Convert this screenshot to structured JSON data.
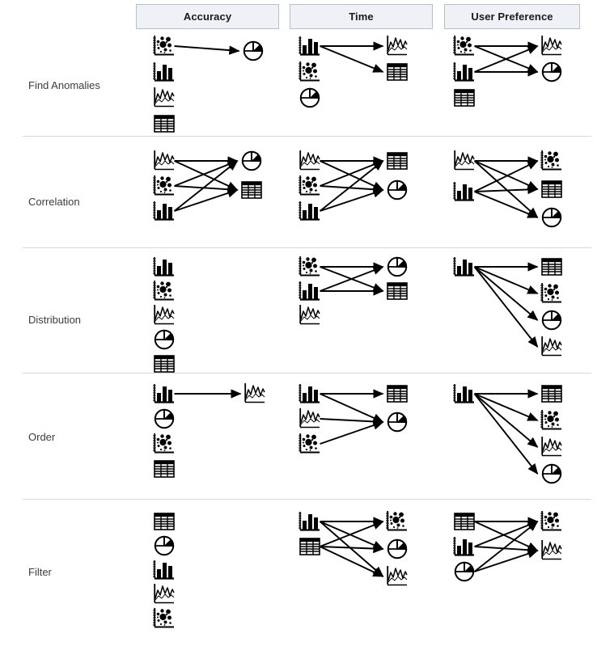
{
  "figure": {
    "type": "matrix-of-directed-graphs",
    "description": "Table of visualization-type preference graphs by task and metric",
    "columns": [
      {
        "id": "accuracy",
        "label": "Accuracy"
      },
      {
        "id": "time",
        "label": "Time"
      },
      {
        "id": "user_preference",
        "label": "User Preference"
      }
    ],
    "row_labels": [
      "Find Anomalies",
      "Correlation",
      "Distribution",
      "Order",
      "Filter"
    ],
    "icon_names": {
      "scatter": "scatter-plot-icon",
      "bar": "bar-chart-icon",
      "line": "line-chart-icon",
      "pie": "pie-chart-icon",
      "table": "table-icon"
    },
    "colors": {
      "header_background": "#eef1f5",
      "header_border": "#b9bfc6",
      "header_text": "#1a1a1a",
      "row_label_text": "#3c3c3c",
      "row_separator": "#d6d8da",
      "ink": "#000000",
      "page_background": "#ffffff"
    }
  },
  "chart_data": {
    "type": "table",
    "title": "",
    "xlabel": "",
    "ylabel": "",
    "categories": [
      "Accuracy",
      "Time",
      "User Preference"
    ],
    "rows": [
      {
        "task": "Find Anomalies",
        "cells": [
          {
            "metric": "Accuracy",
            "left_nodes": [
              "scatter",
              "bar",
              "line",
              "table"
            ],
            "right_nodes": [
              "pie"
            ],
            "edges": [
              [
                "scatter",
                "pie"
              ]
            ]
          },
          {
            "metric": "Time",
            "left_nodes": [
              "bar",
              "scatter",
              "pie"
            ],
            "right_nodes": [
              "line",
              "table"
            ],
            "edges": [
              [
                "bar",
                "line"
              ],
              [
                "bar",
                "table"
              ]
            ]
          },
          {
            "metric": "User Preference",
            "left_nodes": [
              "scatter",
              "bar",
              "table"
            ],
            "right_nodes": [
              "line",
              "pie"
            ],
            "edges": [
              [
                "scatter",
                "line"
              ],
              [
                "scatter",
                "pie"
              ],
              [
                "bar",
                "line"
              ],
              [
                "bar",
                "pie"
              ]
            ]
          }
        ]
      },
      {
        "task": "Correlation",
        "cells": [
          {
            "metric": "Accuracy",
            "left_nodes": [
              "line",
              "scatter",
              "bar"
            ],
            "right_nodes": [
              "pie",
              "table"
            ],
            "edges": [
              [
                "line",
                "pie"
              ],
              [
                "line",
                "table"
              ],
              [
                "scatter",
                "pie"
              ],
              [
                "scatter",
                "table"
              ],
              [
                "bar",
                "pie"
              ],
              [
                "bar",
                "table"
              ]
            ]
          },
          {
            "metric": "Time",
            "left_nodes": [
              "line",
              "scatter",
              "bar"
            ],
            "right_nodes": [
              "table",
              "pie"
            ],
            "edges": [
              [
                "line",
                "table"
              ],
              [
                "line",
                "pie"
              ],
              [
                "scatter",
                "table"
              ],
              [
                "scatter",
                "pie"
              ],
              [
                "bar",
                "table"
              ],
              [
                "bar",
                "pie"
              ]
            ]
          },
          {
            "metric": "User Preference",
            "left_nodes": [
              "line",
              "bar"
            ],
            "right_nodes": [
              "scatter",
              "table",
              "pie"
            ],
            "edges": [
              [
                "line",
                "scatter"
              ],
              [
                "line",
                "table"
              ],
              [
                "line",
                "pie"
              ],
              [
                "bar",
                "scatter"
              ],
              [
                "bar",
                "table"
              ],
              [
                "bar",
                "pie"
              ]
            ]
          }
        ]
      },
      {
        "task": "Distribution",
        "cells": [
          {
            "metric": "Accuracy",
            "left_nodes": [
              "bar",
              "scatter",
              "line",
              "pie",
              "table"
            ],
            "right_nodes": [],
            "edges": []
          },
          {
            "metric": "Time",
            "left_nodes": [
              "scatter",
              "bar",
              "line"
            ],
            "right_nodes": [
              "pie",
              "table"
            ],
            "edges": [
              [
                "scatter",
                "pie"
              ],
              [
                "scatter",
                "table"
              ],
              [
                "bar",
                "pie"
              ],
              [
                "bar",
                "table"
              ]
            ]
          },
          {
            "metric": "User Preference",
            "left_nodes": [
              "bar"
            ],
            "right_nodes": [
              "table",
              "scatter",
              "pie",
              "line"
            ],
            "edges": [
              [
                "bar",
                "table"
              ],
              [
                "bar",
                "scatter"
              ],
              [
                "bar",
                "pie"
              ],
              [
                "bar",
                "line"
              ]
            ]
          }
        ]
      },
      {
        "task": "Order",
        "cells": [
          {
            "metric": "Accuracy",
            "left_nodes": [
              "bar",
              "pie",
              "scatter",
              "table"
            ],
            "right_nodes": [
              "line"
            ],
            "edges": [
              [
                "bar",
                "line"
              ]
            ]
          },
          {
            "metric": "Time",
            "left_nodes": [
              "bar",
              "line",
              "scatter"
            ],
            "right_nodes": [
              "table",
              "pie"
            ],
            "edges": [
              [
                "bar",
                "table"
              ],
              [
                "bar",
                "pie"
              ],
              [
                "line",
                "pie"
              ],
              [
                "scatter",
                "pie"
              ]
            ]
          },
          {
            "metric": "User Preference",
            "left_nodes": [
              "bar"
            ],
            "right_nodes": [
              "table",
              "scatter",
              "line",
              "pie"
            ],
            "edges": [
              [
                "bar",
                "table"
              ],
              [
                "bar",
                "scatter"
              ],
              [
                "bar",
                "line"
              ],
              [
                "bar",
                "pie"
              ]
            ]
          }
        ]
      },
      {
        "task": "Filter",
        "cells": [
          {
            "metric": "Accuracy",
            "left_nodes": [
              "table",
              "pie",
              "bar",
              "line",
              "scatter"
            ],
            "right_nodes": [],
            "edges": []
          },
          {
            "metric": "Time",
            "left_nodes": [
              "bar",
              "table"
            ],
            "right_nodes": [
              "scatter",
              "pie",
              "line"
            ],
            "edges": [
              [
                "bar",
                "scatter"
              ],
              [
                "bar",
                "pie"
              ],
              [
                "bar",
                "line"
              ],
              [
                "table",
                "scatter"
              ],
              [
                "table",
                "pie"
              ],
              [
                "table",
                "line"
              ]
            ]
          },
          {
            "metric": "User Preference",
            "left_nodes": [
              "table",
              "bar",
              "pie"
            ],
            "right_nodes": [
              "scatter",
              "line"
            ],
            "edges": [
              [
                "table",
                "scatter"
              ],
              [
                "table",
                "line"
              ],
              [
                "bar",
                "scatter"
              ],
              [
                "bar",
                "line"
              ],
              [
                "pie",
                "scatter"
              ],
              [
                "pie",
                "line"
              ]
            ]
          }
        ]
      }
    ]
  }
}
